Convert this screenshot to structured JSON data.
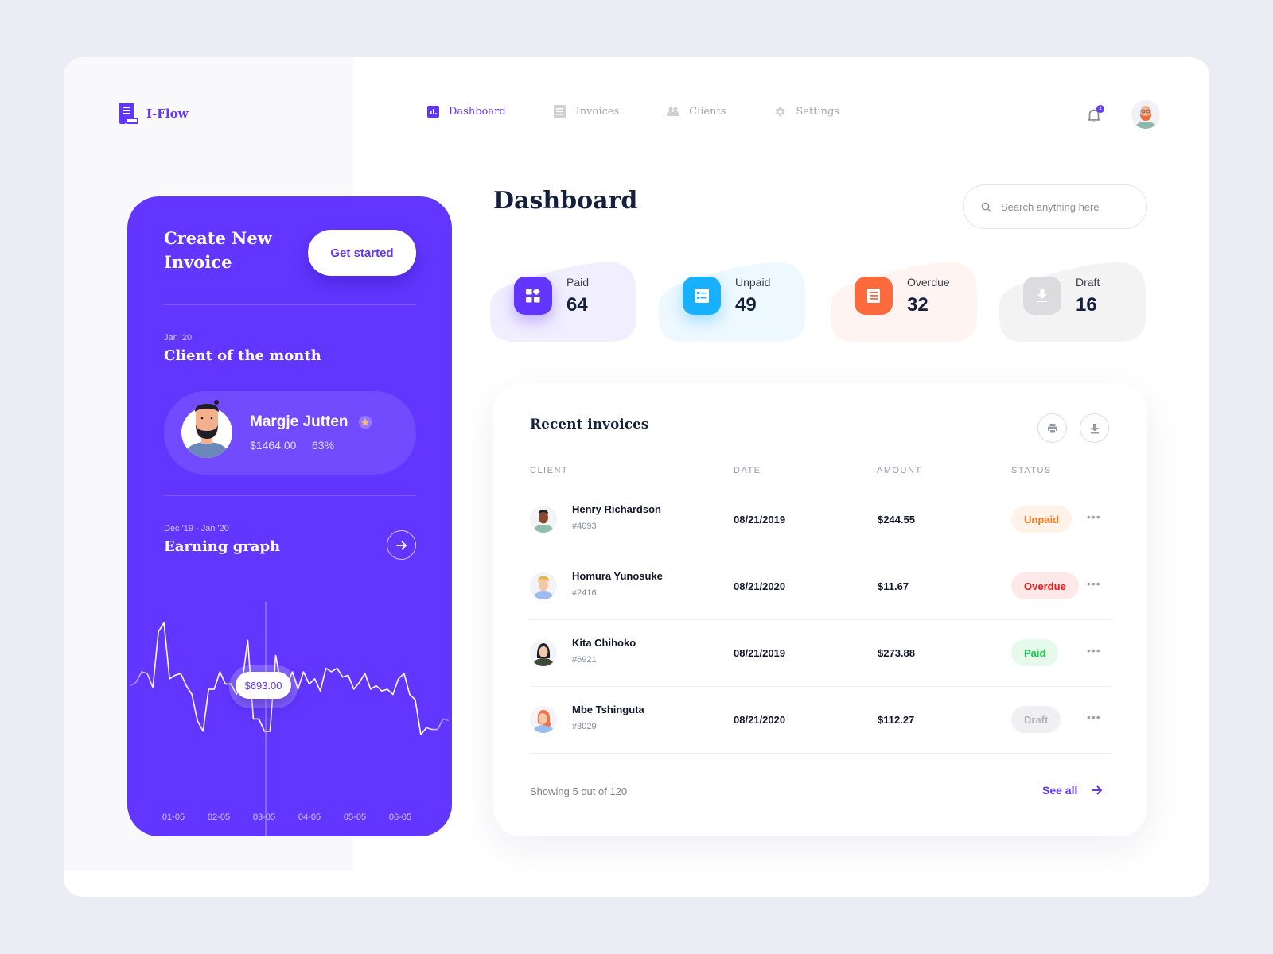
{
  "brand": {
    "name": "I-Flow",
    "accent": "#6236ff"
  },
  "nav": {
    "items": [
      {
        "label": "Dashboard",
        "icon": "bar-chart-icon",
        "active": true
      },
      {
        "label": "Invoices",
        "icon": "document-icon",
        "active": false
      },
      {
        "label": "Clients",
        "icon": "users-icon",
        "active": false
      },
      {
        "label": "Settings",
        "icon": "gear-icon",
        "active": false
      }
    ],
    "notifications_count": "2"
  },
  "promo": {
    "title": "Create New Invoice",
    "cta": "Get started",
    "client_period": "Jan '20",
    "client_section_title": "Client of the month",
    "client": {
      "name": "Margje Jutten",
      "amount": "$1464.00",
      "percent": "63%"
    },
    "graph_period": "Dec '19 - Jan '20",
    "graph_title": "Earning graph",
    "tooltip_value": "$693.00"
  },
  "chart_data": {
    "type": "line",
    "title": "Earning graph",
    "x_tick_labels": [
      "01-05",
      "02-05",
      "03-05",
      "04-05",
      "05-05",
      "06-05"
    ],
    "values": [
      520,
      540,
      600,
      590,
      510,
      830,
      880,
      560,
      580,
      590,
      520,
      470,
      320,
      260,
      500,
      500,
      600,
      530,
      530,
      470,
      540,
      780,
      330,
      330,
      260,
      260,
      693,
      520,
      520,
      600,
      500,
      600,
      530,
      560,
      490,
      620,
      600,
      620,
      570,
      580,
      500,
      540,
      590,
      500,
      520,
      490,
      500,
      470,
      560,
      590,
      470,
      440,
      240,
      280,
      270,
      270,
      330,
      320
    ],
    "highlight_value": "$693.00",
    "highlight_x_label": "03-05",
    "ylim": [
      0,
      1000
    ],
    "grid": false
  },
  "main": {
    "title": "Dashboard",
    "search_placeholder": "Search anything here",
    "stats": [
      {
        "label": "Paid",
        "value": "64",
        "color": "#6236ff",
        "bg": "#f1eeff"
      },
      {
        "label": "Unpaid",
        "value": "49",
        "color": "#18b0ff",
        "bg": "#eef8ff"
      },
      {
        "label": "Overdue",
        "value": "32",
        "color": "#ff6a3d",
        "bg": "#fff4f2"
      },
      {
        "label": "Draft",
        "value": "16",
        "color": "#d8d8dc",
        "bg": "#f3f3f4"
      }
    ]
  },
  "invoices": {
    "title": "Recent invoices",
    "columns": [
      "CLIENT",
      "DATE",
      "AMOUNT",
      "STATUS"
    ],
    "rows": [
      {
        "name": "Henry Richardson",
        "id": "#4093",
        "date": "08/21/2019",
        "amount": "$244.55",
        "status": "Unpaid",
        "status_color": "#ff7a1a",
        "status_bg": "#fff2e8"
      },
      {
        "name": "Homura Yunosuke",
        "id": "#2416",
        "date": "08/21/2020",
        "amount": "$11.67",
        "status": "Overdue",
        "status_color": "#f01818",
        "status_bg": "#ffe8e8"
      },
      {
        "name": "Kita Chihoko",
        "id": "#6921",
        "date": "08/21/2019",
        "amount": "$273.88",
        "status": "Paid",
        "status_color": "#16c94d",
        "status_bg": "#e6faec"
      },
      {
        "name": "Mbe Tshinguta",
        "id": "#3029",
        "date": "08/21/2020",
        "amount": "$112.27",
        "status": "Draft",
        "status_color": "#b4b4bc",
        "status_bg": "#f0f0f3"
      }
    ],
    "footer": "Showing 5 out of 120",
    "see_all": "See all"
  }
}
